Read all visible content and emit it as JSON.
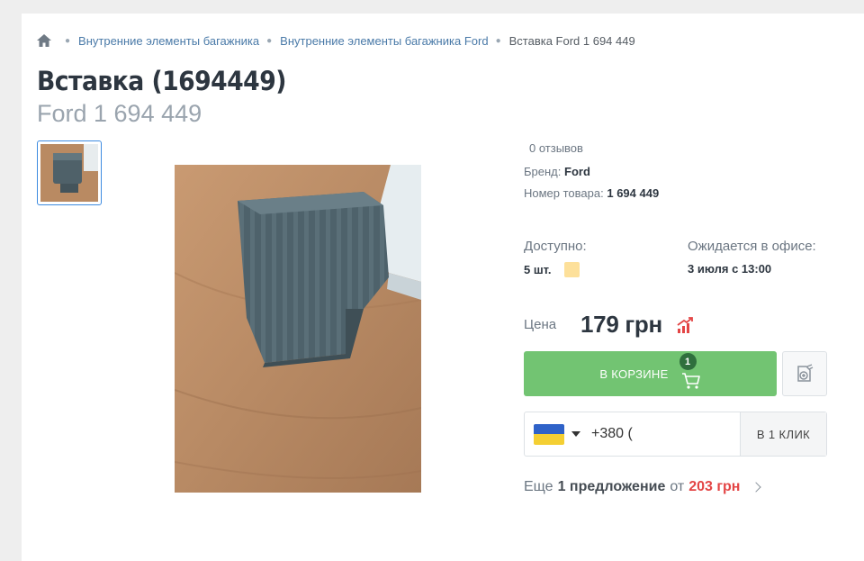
{
  "breadcrumb": {
    "items": [
      "Внутренние элементы багажника",
      "Внутренние элементы багажника Ford"
    ],
    "current": "Вставка Ford 1 694 449"
  },
  "product": {
    "title": "Вставка (1694449)",
    "subtitle": "Ford 1 694 449",
    "reviews": "0 отзывов",
    "brand_label": "Бренд:",
    "brand": "Ford",
    "number_label": "Номер товара:",
    "number": "1 694 449"
  },
  "availability": {
    "label": "Доступно:",
    "value": "5 шт.",
    "indicator_color": "#fde09a",
    "expected_label": "Ожидается в офисе:",
    "expected_value": "3 июля с 13:00"
  },
  "price": {
    "label": "Цена",
    "value": "179 грн"
  },
  "cart": {
    "label": "В КОРЗИНЕ",
    "count": "1",
    "color": "#72c472"
  },
  "phone": {
    "value": "+380 (",
    "country": "ukraine-flag",
    "oneclick_label": "В 1 КЛИК"
  },
  "offers": {
    "prefix": "Еще",
    "count": "1 предложение",
    "from": "от",
    "price": "203 грн"
  }
}
